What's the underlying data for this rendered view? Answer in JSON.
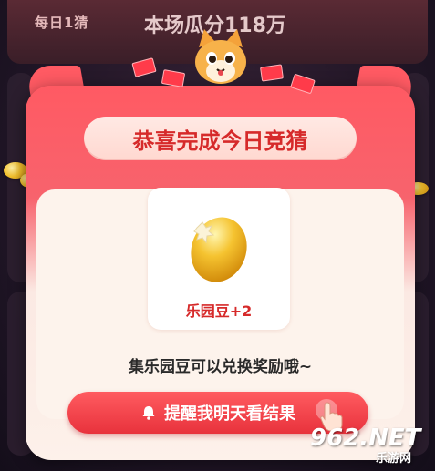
{
  "background": {
    "daily_label": "每日1猜",
    "pool_title": "本场瓜分118万"
  },
  "modal": {
    "title": "恭喜完成今日竞猜",
    "reward": {
      "icon": "gold-bean-icon",
      "label": "乐园豆+2"
    },
    "hint": "集乐园豆可以兑换奖励哦~",
    "remind_button": {
      "icon": "bell-icon",
      "label": "提醒我明天看结果"
    }
  },
  "watermark": {
    "number": "962.NET",
    "site": "乐游网"
  },
  "colors": {
    "accent": "#e8323c",
    "title_red": "#d62a2a",
    "panel": "#fdf3ec"
  }
}
